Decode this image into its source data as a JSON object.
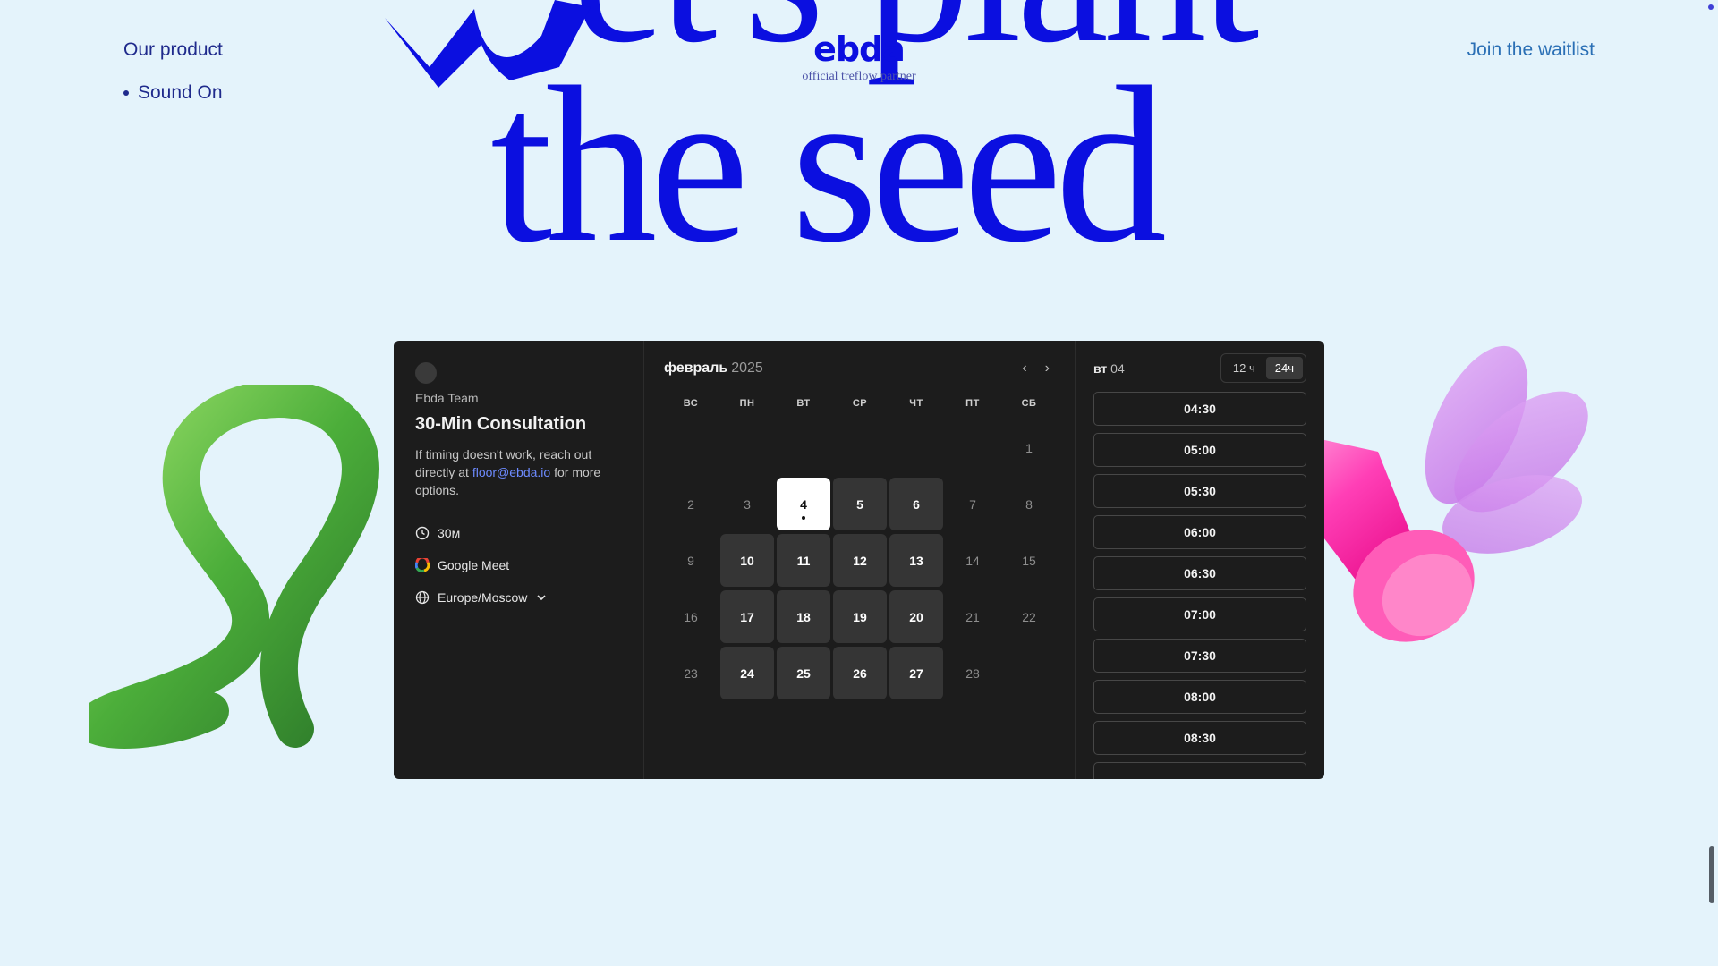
{
  "nav": {
    "product_label": "Our product",
    "product_items": [
      "Sound On"
    ],
    "waitlist_label": "Join the waitlist"
  },
  "hero": {
    "line1": "et's plant",
    "line2": "the seed",
    "color": "#0b0fe0"
  },
  "brand": {
    "logo": "ebda",
    "subtitle": "official treflow partner"
  },
  "booking": {
    "team": "Ebda Team",
    "title": "30-Min Consultation",
    "desc_before": "If timing doesn't work, reach out directly at ",
    "email": "floor@ebda.io",
    "desc_after": " for more options.",
    "duration": "30м",
    "location": "Google Meet",
    "timezone": "Europe/Moscow",
    "calendar": {
      "month": "февраль",
      "year": "2025",
      "weekdays": [
        "ВС",
        "ПН",
        "ВТ",
        "СР",
        "ЧТ",
        "ПТ",
        "СБ"
      ],
      "leading_blanks": 6,
      "days": [
        {
          "d": "1",
          "state": "off"
        },
        {
          "d": "2",
          "state": "off"
        },
        {
          "d": "3",
          "state": "off"
        },
        {
          "d": "4",
          "state": "selected"
        },
        {
          "d": "5",
          "state": "avail"
        },
        {
          "d": "6",
          "state": "avail"
        },
        {
          "d": "7",
          "state": "off"
        },
        {
          "d": "8",
          "state": "off"
        },
        {
          "d": "9",
          "state": "off"
        },
        {
          "d": "10",
          "state": "avail"
        },
        {
          "d": "11",
          "state": "avail"
        },
        {
          "d": "12",
          "state": "avail"
        },
        {
          "d": "13",
          "state": "avail"
        },
        {
          "d": "14",
          "state": "off"
        },
        {
          "d": "15",
          "state": "off"
        },
        {
          "d": "16",
          "state": "off"
        },
        {
          "d": "17",
          "state": "avail"
        },
        {
          "d": "18",
          "state": "avail"
        },
        {
          "d": "19",
          "state": "avail"
        },
        {
          "d": "20",
          "state": "avail"
        },
        {
          "d": "21",
          "state": "off"
        },
        {
          "d": "22",
          "state": "off"
        },
        {
          "d": "23",
          "state": "off"
        },
        {
          "d": "24",
          "state": "avail"
        },
        {
          "d": "25",
          "state": "avail"
        },
        {
          "d": "26",
          "state": "avail"
        },
        {
          "d": "27",
          "state": "avail"
        },
        {
          "d": "28",
          "state": "off"
        }
      ]
    },
    "slots_day": "вт",
    "slots_date": "04",
    "format_12": "12 ч",
    "format_24": "24ч",
    "slots": [
      "04:30",
      "05:00",
      "05:30",
      "06:00",
      "06:30",
      "07:00",
      "07:30",
      "08:00",
      "08:30"
    ]
  }
}
